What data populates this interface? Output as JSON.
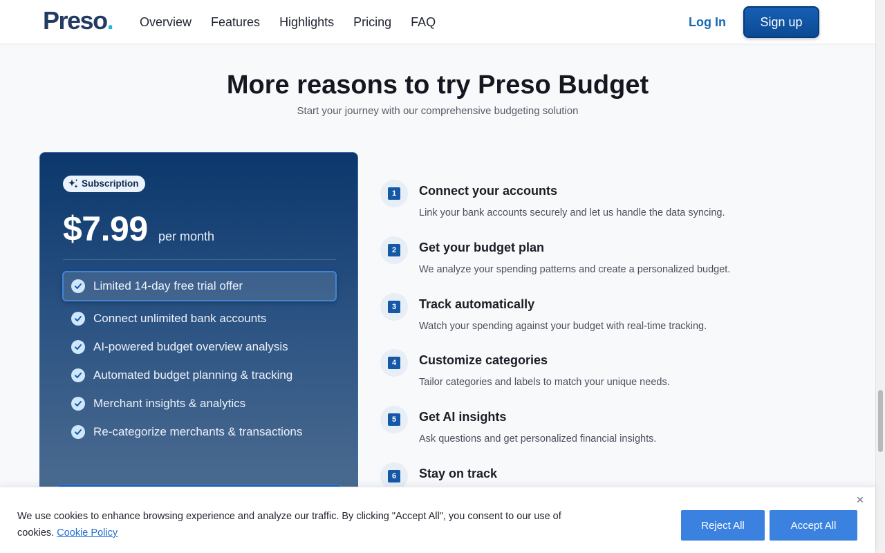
{
  "header": {
    "logo_text": "Preso",
    "logo_dot": ".",
    "nav": [
      "Overview",
      "Features",
      "Highlights",
      "Pricing",
      "FAQ"
    ],
    "login_label": "Log In",
    "signup_label": "Sign up"
  },
  "section": {
    "title": "More reasons to try Preso Budget",
    "subtitle": "Start your journey with our comprehensive budgeting solution"
  },
  "pricing": {
    "badge": "Subscription",
    "price": "$7.99",
    "period": "per month",
    "offer": "Limited 14-day free trial offer",
    "features": [
      "Connect unlimited bank accounts",
      "AI-powered budget overview analysis",
      "Automated budget planning & tracking",
      "Merchant insights & analytics",
      "Re-categorize merchants & transactions"
    ]
  },
  "steps": [
    {
      "num": "1",
      "title": "Connect your accounts",
      "desc": "Link your bank accounts securely and let us handle the data syncing."
    },
    {
      "num": "2",
      "title": "Get your budget plan",
      "desc": "We analyze your spending patterns and create a personalized budget."
    },
    {
      "num": "3",
      "title": "Track automatically",
      "desc": "Watch your spending against your budget with real-time tracking."
    },
    {
      "num": "4",
      "title": "Customize categories",
      "desc": "Tailor categories and labels to match your unique needs."
    },
    {
      "num": "5",
      "title": "Get AI insights",
      "desc": "Ask questions and get personalized financial insights."
    },
    {
      "num": "6",
      "title": "Stay on track",
      "desc": ""
    }
  ],
  "cookie": {
    "text": "We use cookies to enhance browsing experience and analyze our traffic. By clicking \"Accept All\", you consent to our use of cookies.",
    "policy_link": "Cookie Policy",
    "reject_label": "Reject All",
    "accept_label": "Accept All"
  },
  "colors": {
    "brand": "#233b62",
    "accent": "#1fb6d8",
    "primary_button": "#0c4a94",
    "cookie_button": "#3b82e0"
  }
}
